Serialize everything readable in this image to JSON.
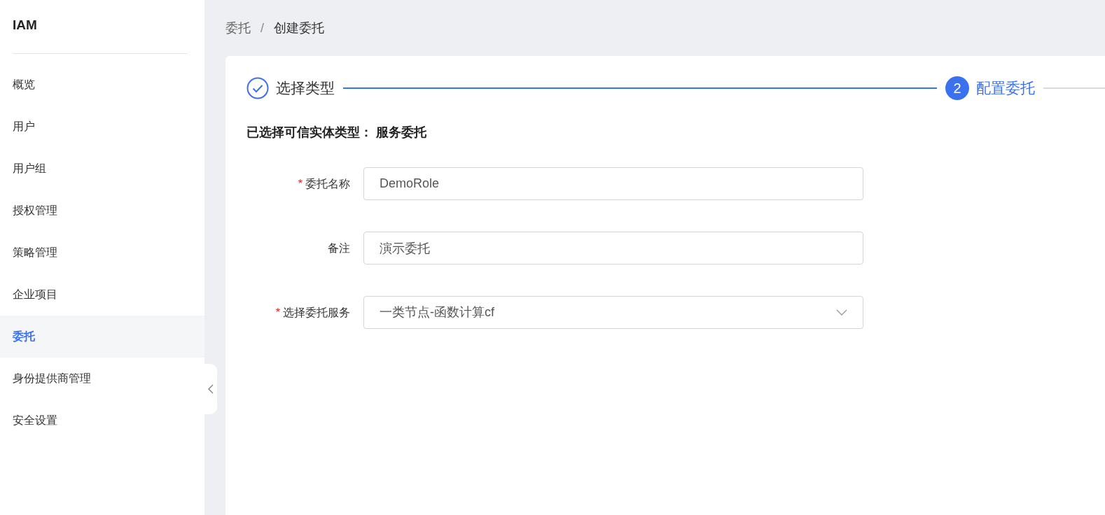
{
  "sidebar": {
    "title": "IAM",
    "items": [
      {
        "label": "概览",
        "selected": false
      },
      {
        "label": "用户",
        "selected": false
      },
      {
        "label": "用户组",
        "selected": false
      },
      {
        "label": "授权管理",
        "selected": false
      },
      {
        "label": "策略管理",
        "selected": false
      },
      {
        "label": "企业项目",
        "selected": false
      },
      {
        "label": "委托",
        "selected": true
      },
      {
        "label": "身份提供商管理",
        "selected": false
      },
      {
        "label": "安全设置",
        "selected": false
      }
    ]
  },
  "breadcrumb": [
    {
      "label": "委托",
      "current": false
    },
    {
      "label": "创建委托",
      "current": true
    }
  ],
  "breadcrumb_separator": "/",
  "steps": [
    {
      "label": "选择类型",
      "completed": true,
      "active": false
    },
    {
      "label": "配置委托",
      "number": "2",
      "completed": false,
      "active": true
    }
  ],
  "summary": {
    "label": "已选择可信实体类型：",
    "value": "服务委托"
  },
  "fields": [
    {
      "kind": "input",
      "required_mark": "*",
      "label": "委托名称",
      "value": "DemoRole"
    },
    {
      "kind": "input",
      "label": "备注",
      "value": "演示委托"
    },
    {
      "kind": "select",
      "required_mark": "*",
      "label": "选择委托服务",
      "value": "一类节点-函数计算cf"
    }
  ]
}
